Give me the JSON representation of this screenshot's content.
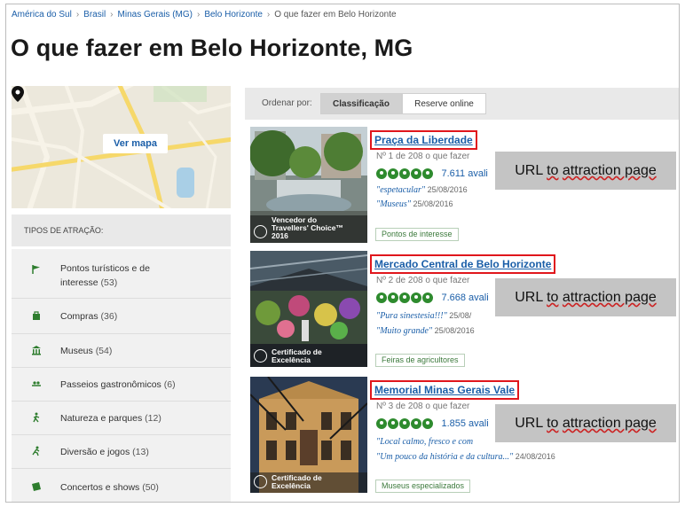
{
  "breadcrumb": {
    "items": [
      "América do Sul",
      "Brasil",
      "Minas Gerais (MG)",
      "Belo Horizonte"
    ],
    "current": "O que fazer em Belo Horizonte",
    "separator": "›"
  },
  "page_title": "O que fazer em Belo Horizonte, MG",
  "map": {
    "button_label": "Ver mapa"
  },
  "filters": {
    "header": "TIPOS DE ATRAÇÃO:",
    "categories": [
      {
        "label": "Pontos turísticos e de",
        "label2": "interesse",
        "count": "(53)",
        "icon": "flag-icon"
      },
      {
        "label": "Compras",
        "count": "(36)",
        "icon": "shopping-bag-icon"
      },
      {
        "label": "Museus",
        "count": "(54)",
        "icon": "museum-icon"
      },
      {
        "label": "Passeios gastronômicos",
        "count": "(6)",
        "icon": "food-tour-icon"
      },
      {
        "label": "Natureza e parques",
        "count": "(12)",
        "icon": "hiker-icon"
      },
      {
        "label": "Diversão e jogos",
        "count": "(13)",
        "icon": "runner-icon"
      },
      {
        "label": "Concertos e shows",
        "count": "(50)",
        "icon": "ticket-icon"
      }
    ]
  },
  "sort": {
    "label": "Ordenar por:",
    "options": [
      "Classificação",
      "Reserve online"
    ],
    "active": "Classificação"
  },
  "listings": [
    {
      "title": "Praça da Liberdade",
      "rank": "Nº 1 de 208 o que fazer",
      "reviews": "7.611 avali",
      "quotes": [
        {
          "text": "\"espetacular\"",
          "date": "25/08/2016"
        },
        {
          "text": "\"Museus\"",
          "date": "25/08/2016"
        }
      ],
      "tag": "Pontos de interesse",
      "badge": [
        "Vencedor do",
        "Travellers' Choice™",
        "2016"
      ],
      "overlay": {
        "a": "URL",
        "b": "to",
        "c": "attraction page"
      }
    },
    {
      "title": "Mercado Central de Belo Horizonte",
      "rank": "Nº 2 de 208 o que fazer",
      "reviews": "7.668 avali",
      "quotes": [
        {
          "text": "\"Pura sinestesia!!!\"",
          "date": "25/08/"
        },
        {
          "text": "\"Muito grande\"",
          "date": "25/08/2016"
        }
      ],
      "tag": "Feiras de agricultores",
      "badge": [
        "Certificado de",
        "Excelência"
      ],
      "overlay": {
        "a": "URL",
        "b": "to",
        "c": "attraction page"
      }
    },
    {
      "title": "Memorial Minas Gerais Vale",
      "rank": "Nº 3 de 208 o que fazer",
      "reviews": "1.855 avali",
      "quotes": [
        {
          "text": "\"Local calmo, fresco e com",
          "date": ""
        },
        {
          "text": "\"Um pouco da história e da cultura...\"",
          "date": "24/08/2016"
        }
      ],
      "tag": "Museus especializados",
      "badge": [
        "Certificado de",
        "Excelência"
      ],
      "overlay": {
        "a": "URL",
        "b": "to",
        "c": "attraction page"
      }
    }
  ],
  "colors": {
    "link": "#1a5ea8",
    "highlight": "#e0161c",
    "rating": "#2e8b2e",
    "overlay": "#c4c4c4"
  }
}
